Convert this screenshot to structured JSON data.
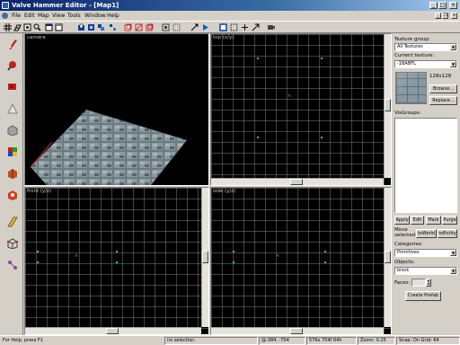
{
  "window": {
    "title": "Valve Hammer Editor - [Map1]",
    "minimize": "_",
    "maximize": "□",
    "close": "×"
  },
  "menu": {
    "items": [
      "File",
      "Edit",
      "Map",
      "View",
      "Tools",
      "Window",
      "Help"
    ],
    "doc_minimize": "_",
    "doc_restore": "❐",
    "doc_close": "×"
  },
  "viewports": {
    "camera": {
      "label": "camera"
    },
    "top": {
      "label": "top (x/y)"
    },
    "front": {
      "label": "front (y/z)"
    },
    "side": {
      "label": "side (y/z)"
    }
  },
  "right_panel": {
    "texture_group_label": "Texture group:",
    "texture_group_value": "All Textures",
    "current_texture_label": "Current texture:",
    "current_texture_value": "-1BABFL",
    "texture_size": "128x128",
    "browse_button": "Browse...",
    "replace_button": "Replace...",
    "visgroups_label": "VisGroups:",
    "apply_button": "Apply",
    "edit_button": "Edit",
    "mark_button": "Mark",
    "purge_button": "Purge",
    "move_selected_label": "Move selected:",
    "to_world_button": "toWorld",
    "to_entity_button": "toEntity",
    "categories_label": "Categories:",
    "categories_value": "Primitives",
    "objects_label": "Objects:",
    "objects_value": "block",
    "faces_label": "Faces:",
    "create_prefab_button": "Create Prefab"
  },
  "status": {
    "help": "For Help, press F1",
    "selection": "no selection.",
    "coords": "@-384, -704",
    "dims": "576x 704f 64h",
    "zoom": "Zoom: 0.25",
    "snap": "Snap: On Grid: 64"
  },
  "colors": {
    "titlebar": "#0a246a",
    "vertex": "#00c8c8",
    "grid": "#787878"
  },
  "icons": {
    "toolbar": [
      "grid-icon",
      "3d-grid-icon",
      "snap-icon",
      "zoom-icon",
      "load-window-icon",
      "save-window-icon",
      "carve-icon",
      "hollow-icon",
      "group-icon",
      "ungroup-icon",
      "hide-icon",
      "texture-lock-icon",
      "entity-icon",
      "toWorld-icon",
      "run-map-icon"
    ],
    "tools": [
      "selection-tool-icon",
      "magnify-tool-icon",
      "camera-tool-icon",
      "entity-tool-icon",
      "block-tool-icon",
      "texture-app-icon",
      "apply-texture-icon",
      "decal-tool-icon",
      "clip-tool-icon",
      "vertex-tool-icon",
      "path-tool-icon"
    ]
  }
}
